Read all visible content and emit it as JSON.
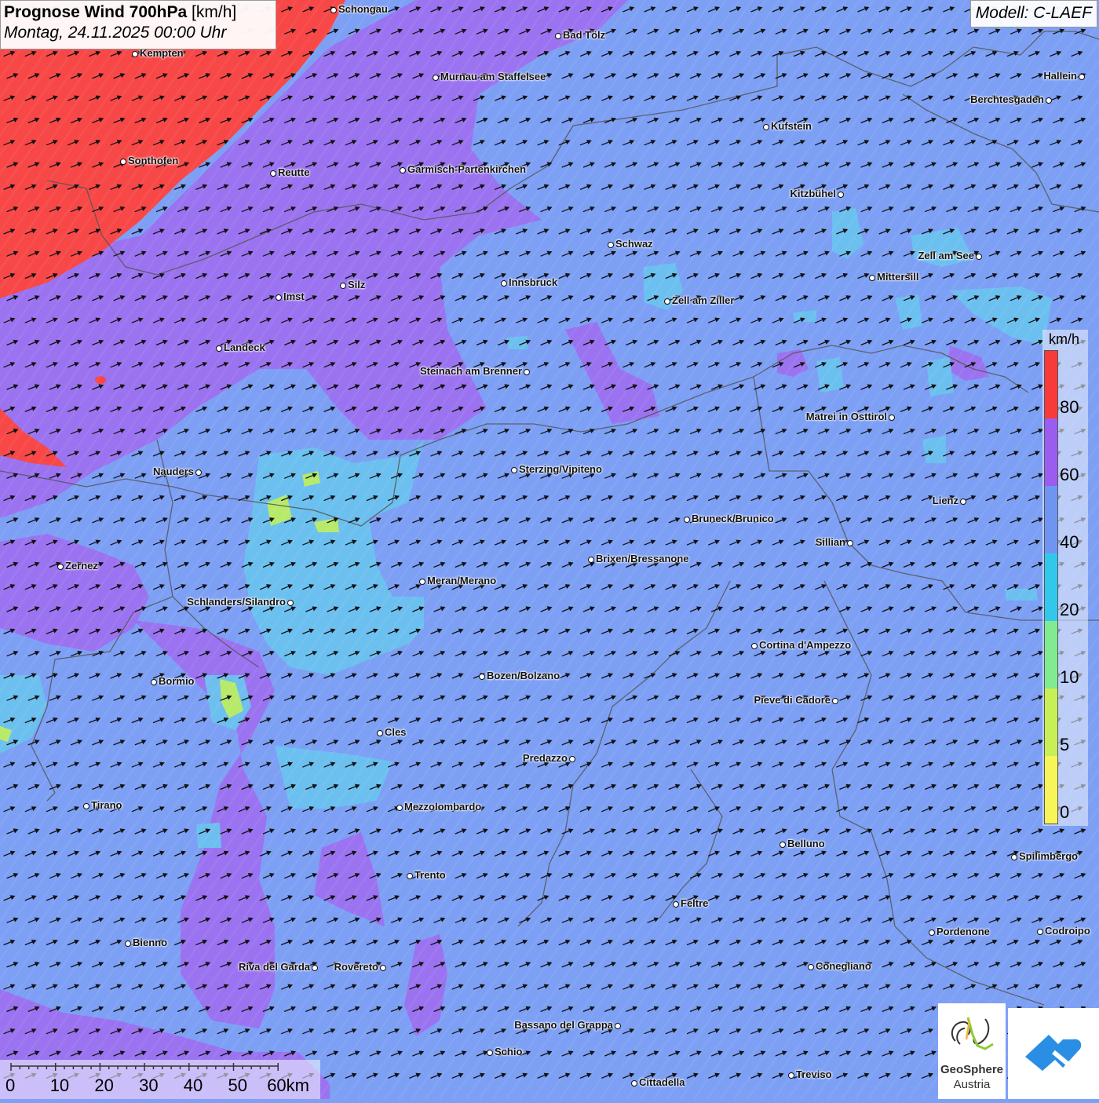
{
  "title": {
    "main": "Prognose Wind 700hPa",
    "unit": "[km/h]",
    "date": "Montag, 24.11.2025 00:00 Uhr"
  },
  "model": "Modell: C-LAEF",
  "legend": {
    "unit": "km/h",
    "labels": [
      "80",
      "60",
      "40",
      "20",
      "10",
      "5",
      "0"
    ],
    "colors": [
      "#f83a3a",
      "#9b5cf0",
      "#6f95f2",
      "#32c8ec",
      "#80eb90",
      "#c8ef56",
      "#f8f558"
    ]
  },
  "scale": {
    "ticks": [
      "0",
      "10",
      "20",
      "30",
      "40",
      "50",
      "60km"
    ]
  },
  "logos": {
    "geosphere_name": "GeoSphere",
    "geosphere_country": "Austria"
  },
  "colors": {
    "background": "#7da0f5",
    "red_zone": "#f84747",
    "purple_zone": "#9e6ef0",
    "cyan_zone": "#6cc2ee",
    "green_zone": "#b7ea6a",
    "wind_arrow": "#111111",
    "border": "#555555"
  },
  "wind": {
    "direction": "from west-southwest",
    "arrow_icon": "wind-arrow-icon"
  },
  "cities": [
    "Schongau",
    "Bad Tölz",
    "Kempten",
    "Murnau am Staffelsee",
    "Hallein",
    "Berchtesgaden",
    "Kufstein",
    "Sonthofen",
    "Reutte",
    "Garmisch-Partenkirchen",
    "Kitzbühel",
    "Schwaz",
    "Zell am See",
    "Mittersill",
    "Innsbruck",
    "Zell am Ziller",
    "Imst",
    "Silz",
    "Landeck",
    "Steinach am Brenner",
    "Matrei in Osttirol",
    "Nauders",
    "Sterzing/Vipiteno",
    "Lienz",
    "Bruneck/Brunico",
    "Sillian",
    "Brixen/Bressanone",
    "Zernez",
    "Meran/Merano",
    "Schlanders/Silandro",
    "Cortina d'Ampezzo",
    "Bozen/Bolzano",
    "Bormio",
    "Pieve di Cadore",
    "Cles",
    "Predazzo",
    "Tirano",
    "Mezzolombardo",
    "Belluno",
    "Spilimbergo",
    "Trento",
    "Feltre",
    "Pordenone",
    "Codroipo",
    "Bienno",
    "Riva del Garda",
    "Rovereto",
    "Conegliano",
    "Bassano del Grappa",
    "Schio",
    "Treviso",
    "Cittadella"
  ]
}
